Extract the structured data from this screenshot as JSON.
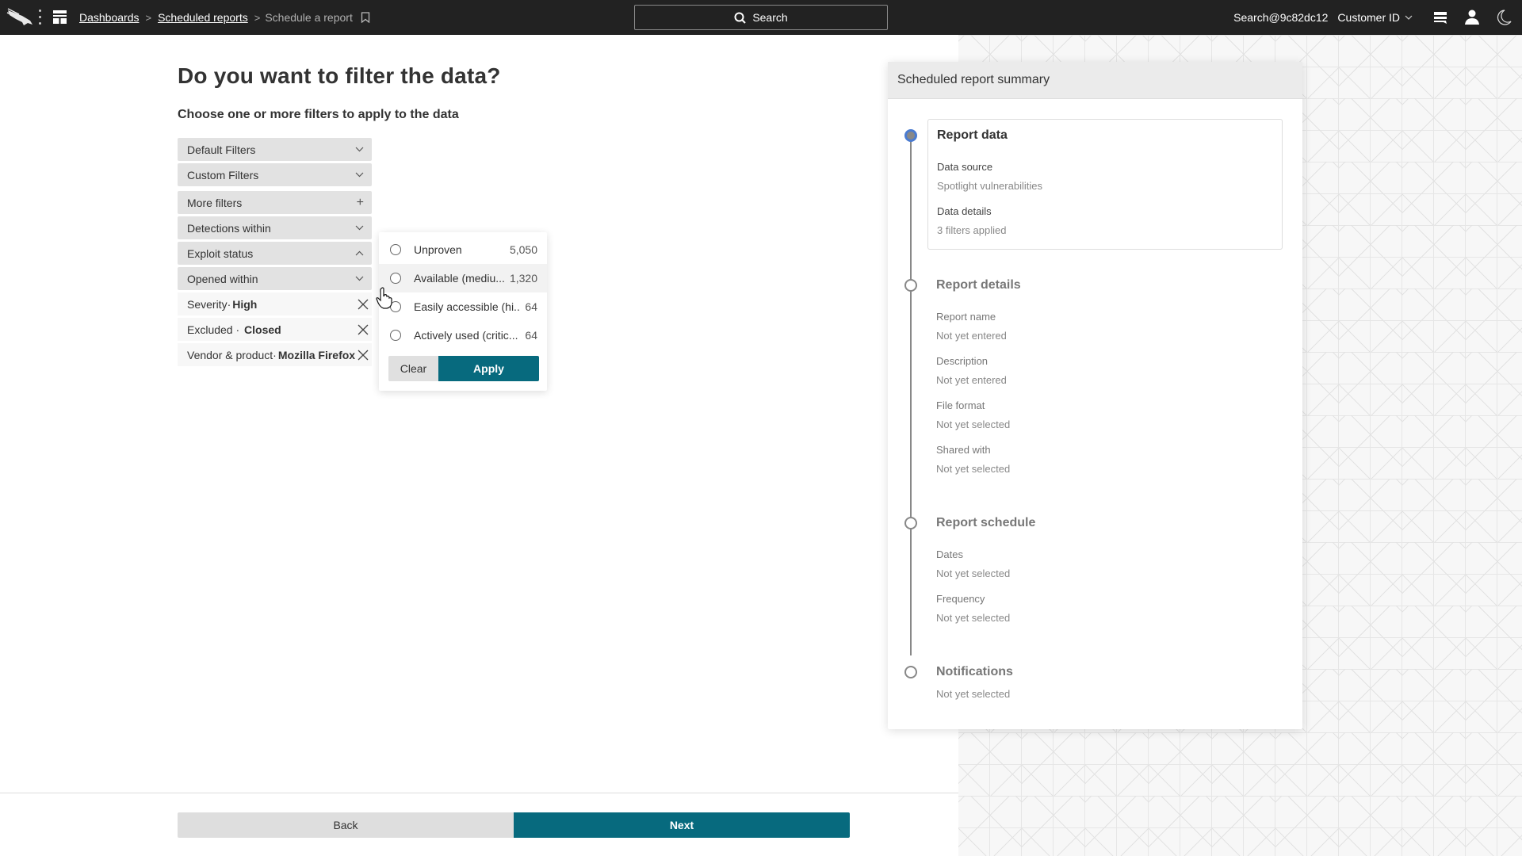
{
  "header": {
    "breadcrumbs": [
      {
        "label": "Dashboards",
        "link": true
      },
      {
        "label": "Scheduled reports",
        "link": true
      },
      {
        "label": "Schedule a report",
        "link": false
      }
    ],
    "search_label": "Search",
    "user": "Search@9c82dc12",
    "customer_label": "Customer ID",
    "icons": [
      "falcon-logo-icon",
      "kebab-menu-icon",
      "dashboard-icon",
      "bookmark-icon",
      "search-icon",
      "chevron-down-icon",
      "messages-icon",
      "user-icon",
      "moon-icon"
    ]
  },
  "main": {
    "title": "Do you want to filter the data?",
    "subtitle": "Choose one or more filters to apply to the data",
    "filter_groups": [
      {
        "label": "Default Filters",
        "icon": "chevron-down"
      },
      {
        "label": "Custom Filters",
        "icon": "chevron-down"
      }
    ],
    "filter_rows": [
      {
        "label": "More filters",
        "icon": "plus"
      },
      {
        "label": "Detections within",
        "icon": "chevron-down"
      },
      {
        "label": "Exploit status",
        "icon": "chevron-up"
      },
      {
        "label": "Opened within",
        "icon": "chevron-down"
      }
    ],
    "applied_filters": [
      {
        "key": "Severity·",
        "value": "High"
      },
      {
        "key": "Excluded ·",
        "value": "Closed"
      },
      {
        "key": "Vendor & product·",
        "value": "Mozilla Firefox"
      }
    ]
  },
  "exploit_popup": {
    "options": [
      {
        "label": "Unproven",
        "count": "5,050",
        "selected": false
      },
      {
        "label": "Available (mediu...",
        "count": "1,320",
        "selected": false
      },
      {
        "label": "Easily accessible (hi...",
        "count": "64",
        "selected": false
      },
      {
        "label": "Actively used (critic...",
        "count": "64",
        "selected": false
      }
    ],
    "clear_label": "Clear",
    "apply_label": "Apply"
  },
  "summary": {
    "title": "Scheduled report summary",
    "sections": {
      "report_data": {
        "title": "Report data",
        "items": [
          {
            "label": "Data source",
            "value": "Spotlight vulnerabilities"
          },
          {
            "label": "Data details",
            "value": "3 filters applied"
          }
        ]
      },
      "report_details": {
        "title": "Report details",
        "items": [
          {
            "label": "Report name",
            "value": "Not yet entered"
          },
          {
            "label": "Description",
            "value": "Not yet entered"
          },
          {
            "label": "File format",
            "value": "Not yet selected"
          },
          {
            "label": "Shared with",
            "value": "Not yet selected"
          }
        ]
      },
      "report_schedule": {
        "title": "Report schedule",
        "items": [
          {
            "label": "Dates",
            "value": "Not yet selected"
          },
          {
            "label": "Frequency",
            "value": "Not yet selected"
          }
        ]
      },
      "notifications": {
        "title": "Notifications",
        "value": "Not yet selected"
      }
    }
  },
  "footer": {
    "back_label": "Back",
    "next_label": "Next"
  },
  "colors": {
    "accent": "#076a7e",
    "topbar": "#222222",
    "active_step": "#4a7bd0"
  }
}
